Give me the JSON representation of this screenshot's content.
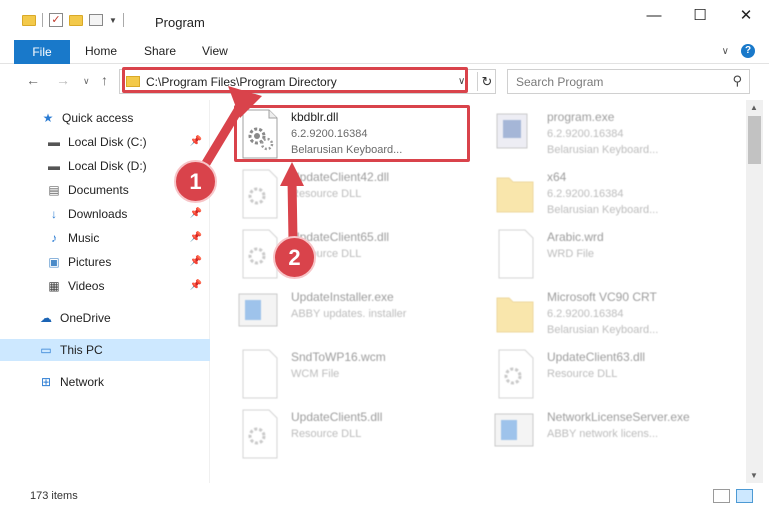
{
  "window": {
    "title": "Program",
    "controls": [
      "—",
      "☐",
      "✕"
    ]
  },
  "ribbon": {
    "file_label": "File",
    "tabs": [
      "Home",
      "Share",
      "View"
    ]
  },
  "address": {
    "path": "C:\\Program Files\\Program Directory"
  },
  "search": {
    "placeholder": "Search Program"
  },
  "sidebar": {
    "items": [
      {
        "label": "Quick access",
        "icon": "star-icon",
        "pinned": false
      },
      {
        "label": "Local Disk (C:)",
        "icon": "drive-icon",
        "pinned": true
      },
      {
        "label": "Local Disk (D:)",
        "icon": "drive-icon",
        "pinned": false
      },
      {
        "label": "Documents",
        "icon": "documents-icon",
        "pinned": false
      },
      {
        "label": "Downloads",
        "icon": "download-icon",
        "pinned": true
      },
      {
        "label": "Music",
        "icon": "music-icon",
        "pinned": true
      },
      {
        "label": "Pictures",
        "icon": "pictures-icon",
        "pinned": true
      },
      {
        "label": "Videos",
        "icon": "videos-icon",
        "pinned": true
      },
      {
        "label": "OneDrive",
        "icon": "cloud-icon",
        "pinned": false
      },
      {
        "label": "This PC",
        "icon": "computer-icon",
        "pinned": false,
        "selected": true
      },
      {
        "label": "Network",
        "icon": "network-icon",
        "pinned": false
      }
    ]
  },
  "files": [
    {
      "name": "kbdblr.dll",
      "line1": "6.2.9200.16384",
      "line2": "Belarusian Keyboard...",
      "icon": "dll-gear-icon",
      "highlighted": true
    },
    {
      "name": "program.exe",
      "line1": "6.2.9200.16384",
      "line2": "Belarusian Keyboard...",
      "icon": "exe-icon"
    },
    {
      "name": "UpdateClient42.dll",
      "line1": "Resource DLL",
      "line2": "",
      "icon": "dll-gear-icon"
    },
    {
      "name": "x64",
      "line1": "6.2.9200.16384",
      "line2": "Belarusian Keyboard...",
      "icon": "folder-icon"
    },
    {
      "name": "UpdateClient65.dll",
      "line1": "Resource DLL",
      "line2": "",
      "icon": "dll-gear-icon"
    },
    {
      "name": "Arabic.wrd",
      "line1": "WRD File",
      "line2": "",
      "icon": "document-icon"
    },
    {
      "name": "UpdateInstaller.exe",
      "line1": "ABBY updates. installer",
      "line2": "",
      "icon": "installer-icon"
    },
    {
      "name": "Microsoft VC90 CRT",
      "line1": "6.2.9200.16384",
      "line2": "Belarusian Keyboard...",
      "icon": "folder-icon"
    },
    {
      "name": "SndToWP16.wcm",
      "line1": "WCM File",
      "line2": "",
      "icon": "document-icon"
    },
    {
      "name": "UpdateClient63.dll",
      "line1": "Resource DLL",
      "line2": "",
      "icon": "dll-gear-icon"
    },
    {
      "name": "UpdateClient5.dll",
      "line1": "Resource DLL",
      "line2": "",
      "icon": "dll-gear-icon"
    },
    {
      "name": "NetworkLicenseServer.exe",
      "line1": "ABBY network licens...",
      "line2": "",
      "icon": "installer-icon"
    }
  ],
  "status": {
    "count": "173 items"
  },
  "callouts": [
    "1",
    "2"
  ],
  "colors": {
    "accent": "#1979ca",
    "highlight": "#d9434b",
    "selected": "#cde8ff"
  }
}
